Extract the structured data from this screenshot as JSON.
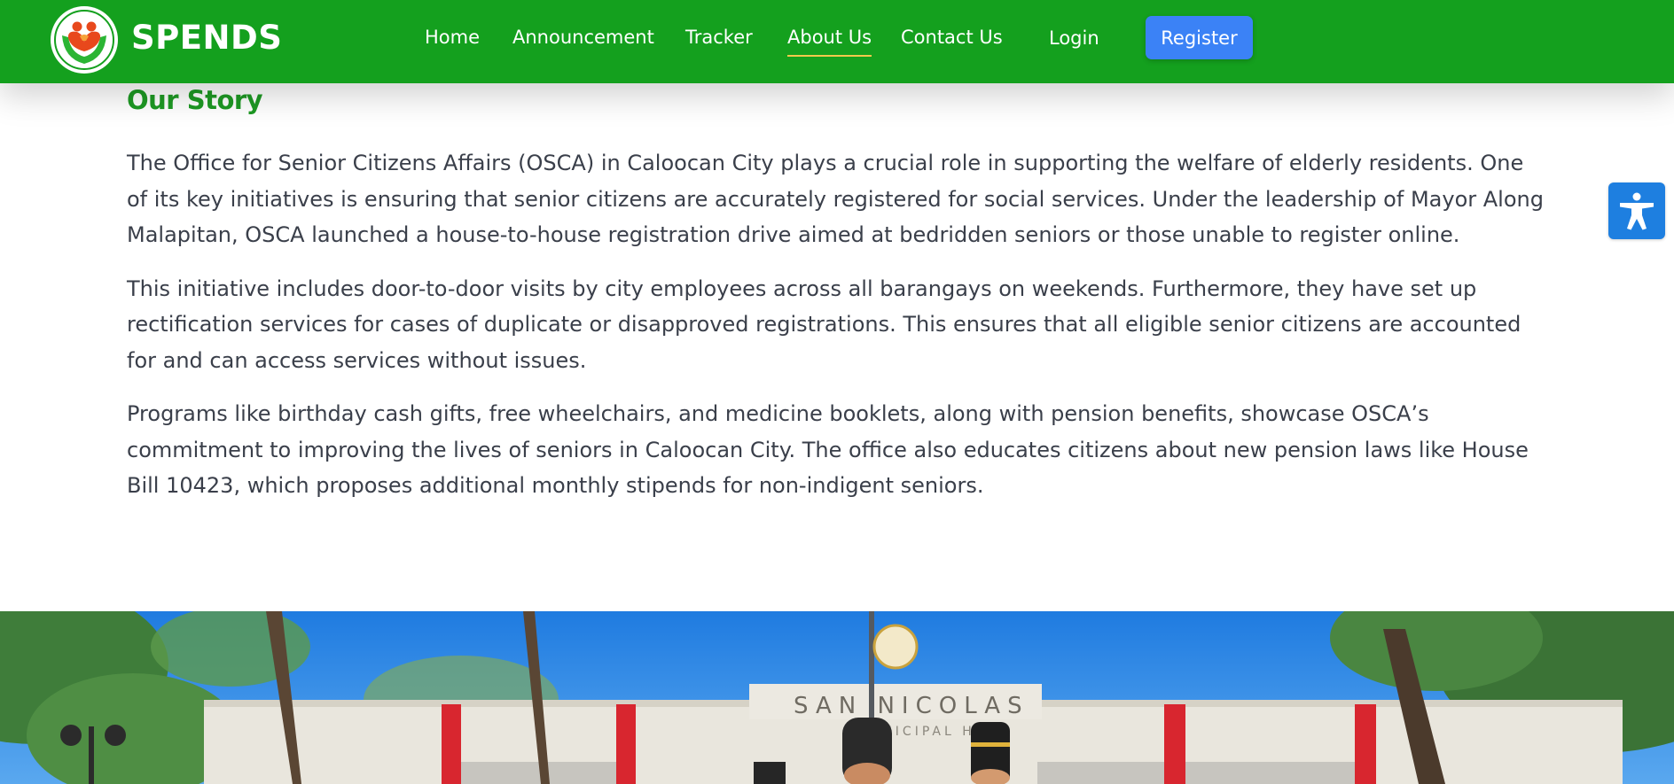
{
  "navbar": {
    "brand": "SPENDS",
    "logo_icon": "senior-care-hands-icon",
    "links": [
      {
        "label": "Home",
        "active": false
      },
      {
        "label": "Announcement",
        "active": false
      },
      {
        "label": "Tracker",
        "active": false
      },
      {
        "label": "About Us",
        "active": true
      },
      {
        "label": "Contact Us",
        "active": false
      }
    ],
    "login_label": "Login",
    "register_label": "Register"
  },
  "story": {
    "title": "Our Story",
    "paragraphs": [
      "The Office for Senior Citizens Affairs (OSCA) in Caloocan City plays a crucial role in supporting the welfare of elderly residents. One of its key initiatives is ensuring that senior citizens are accurately registered for social services. Under the leadership of Mayor Along Malapitan, OSCA launched a house-to-house registration drive aimed at bedridden seniors or those unable to register online.",
      "This initiative includes door-to-door visits by city employees across all barangays on weekends. Furthermore, they have set up rectification services for cases of duplicate or disapproved registrations. This ensures that all eligible senior citizens are accounted for and can access services without issues.",
      "Programs like birthday cash gifts, free wheelchairs, and medicine booklets, along with pension benefits, showcase OSCA’s commitment to improving the lives of seniors in Caloocan City. The office also educates citizens about new pension laws like House Bill 10423, which proposes additional monthly stipends for non-indigent seniors."
    ]
  },
  "photo": {
    "building_sign": "SAN NICOLAS",
    "building_subsign": "MUNICIPAL HALL"
  },
  "accessibility": {
    "icon": "accessibility-person-icon"
  },
  "colors": {
    "nav_green": "#14a01e",
    "title_green": "#1e9a24",
    "register_blue": "#3b82f6",
    "accessibility_blue": "#1e7fe0",
    "active_underline": "#f2c94c",
    "body_text": "#3a3f4a"
  }
}
